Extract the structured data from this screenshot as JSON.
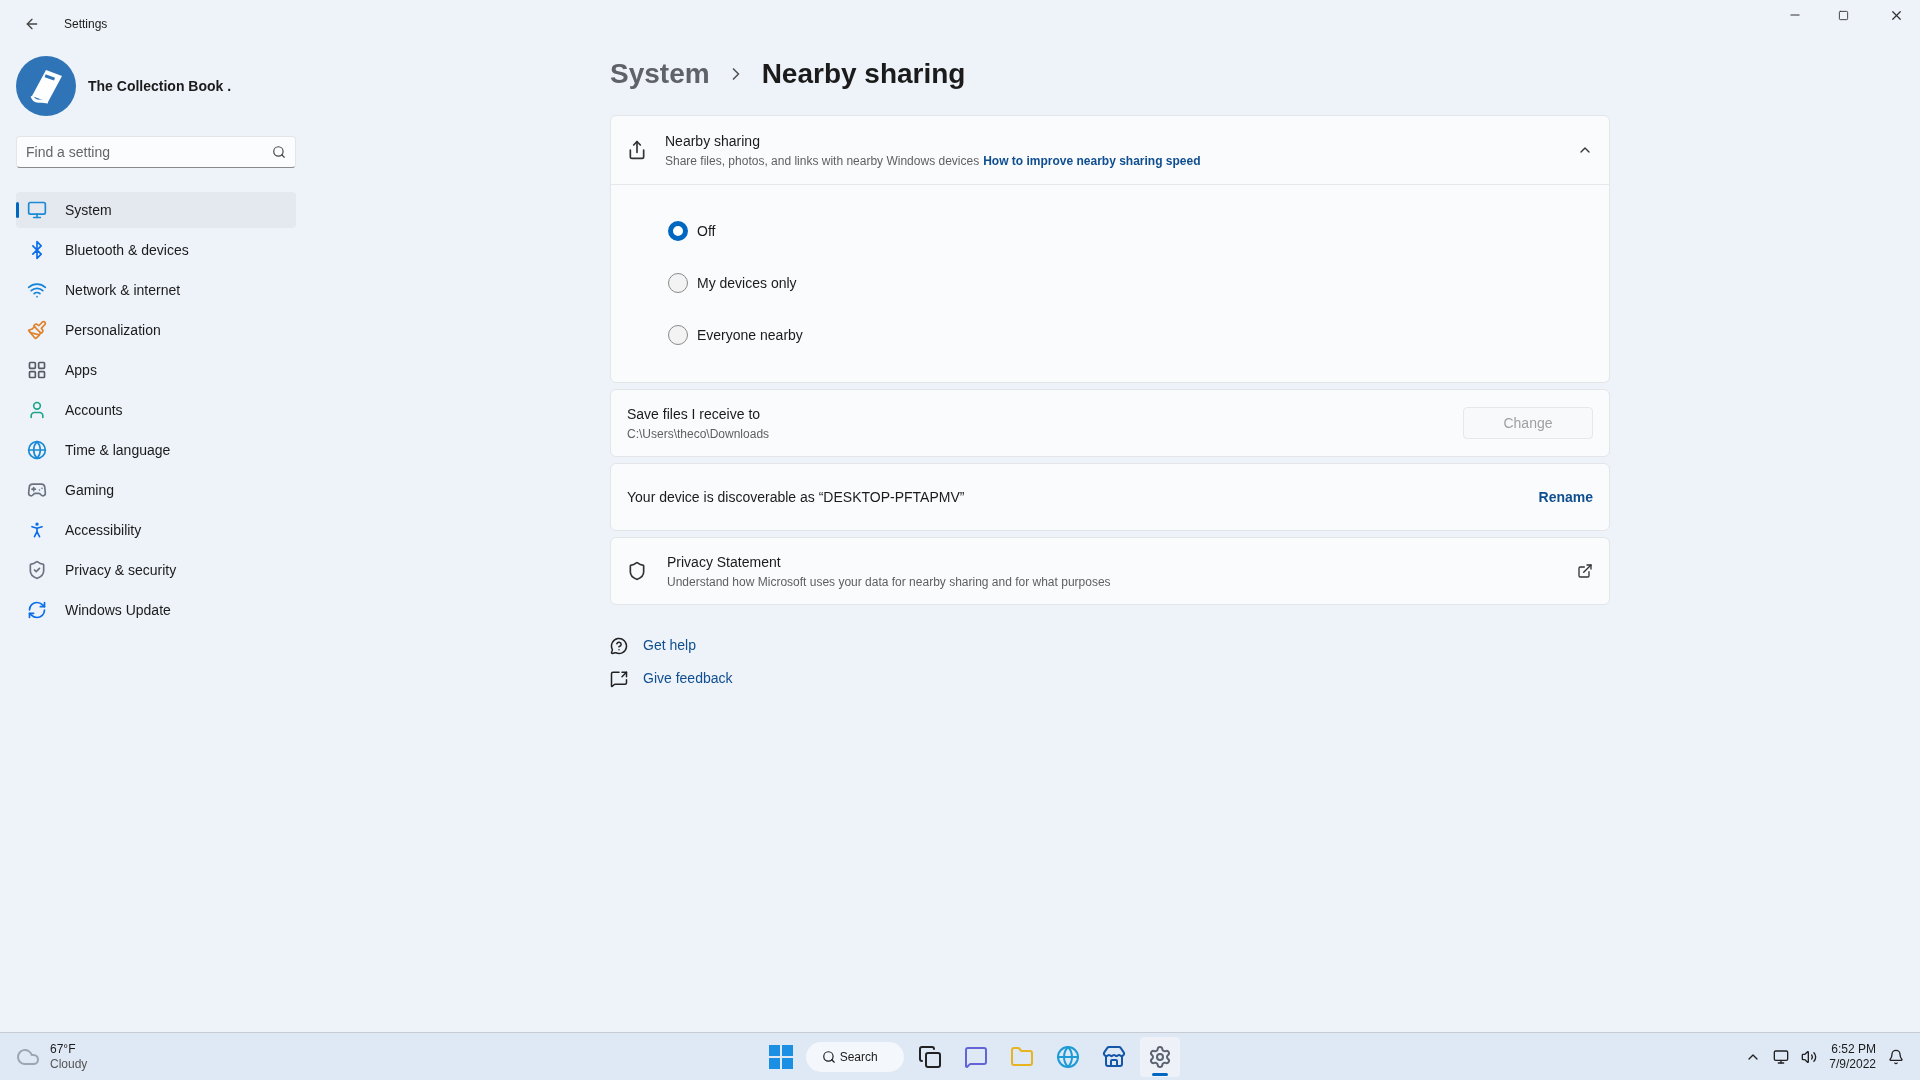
{
  "window": {
    "title": "Settings"
  },
  "profile": {
    "name": "The Collection Book ."
  },
  "search": {
    "placeholder": "Find a setting"
  },
  "sidebar": {
    "items": [
      {
        "label": "System",
        "selected": true
      },
      {
        "label": "Bluetooth & devices",
        "selected": false
      },
      {
        "label": "Network & internet",
        "selected": false
      },
      {
        "label": "Personalization",
        "selected": false
      },
      {
        "label": "Apps",
        "selected": false
      },
      {
        "label": "Accounts",
        "selected": false
      },
      {
        "label": "Time & language",
        "selected": false
      },
      {
        "label": "Gaming",
        "selected": false
      },
      {
        "label": "Accessibility",
        "selected": false
      },
      {
        "label": "Privacy & security",
        "selected": false
      },
      {
        "label": "Windows Update",
        "selected": false
      }
    ]
  },
  "breadcrumb": [
    "System",
    "Nearby sharing"
  ],
  "nearby": {
    "title": "Nearby sharing",
    "description": "Share files, photos, and links with nearby Windows devices",
    "link": "How to improve nearby sharing speed",
    "expanded": true,
    "options": [
      {
        "label": "Off",
        "selected": true
      },
      {
        "label": "My devices only",
        "selected": false
      },
      {
        "label": "Everyone nearby",
        "selected": false
      }
    ]
  },
  "save_location": {
    "title": "Save files I receive to",
    "path": "C:\\Users\\theco\\Downloads",
    "button": "Change",
    "disabled": true
  },
  "discoverable": {
    "text": "Your device is discoverable as “DESKTOP-PFTAPMV”",
    "action": "Rename"
  },
  "privacy": {
    "title": "Privacy Statement",
    "description": "Understand how Microsoft uses your data for nearby sharing and for what purposes"
  },
  "help_links": [
    {
      "label": "Get help"
    },
    {
      "label": "Give feedback"
    }
  ],
  "taskbar": {
    "weather": {
      "temp": "67°F",
      "condition": "Cloudy"
    },
    "search": "Search",
    "apps": [
      {
        "selected": false
      },
      {
        "selected": false
      },
      {
        "selected": false
      },
      {
        "selected": false
      },
      {
        "selected": false
      },
      {
        "selected": true
      }
    ],
    "time": "6:52 PM",
    "date": "7/9/2022"
  }
}
